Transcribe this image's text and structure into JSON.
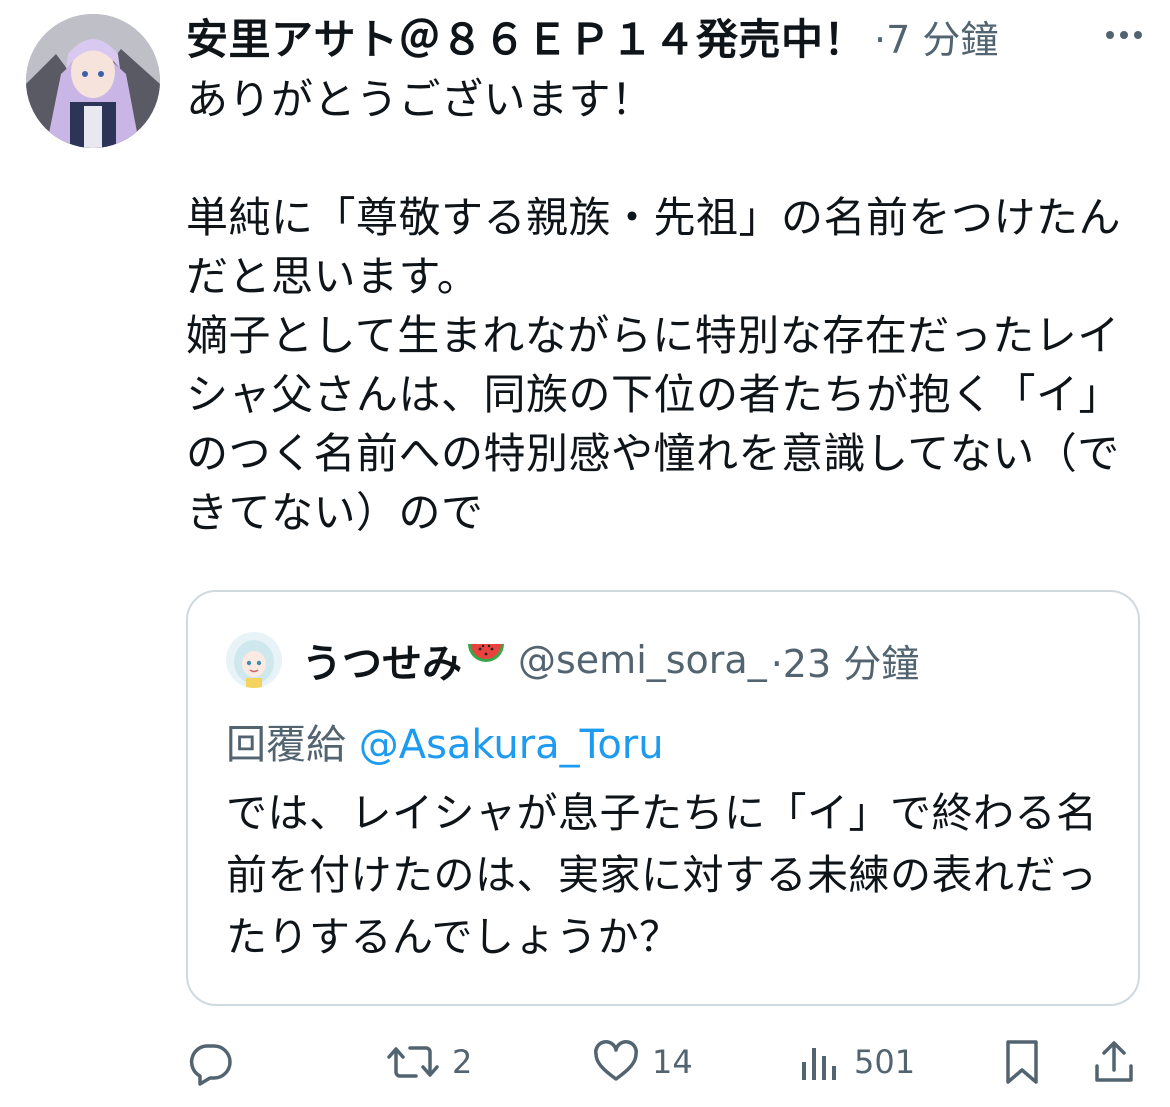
{
  "tweet": {
    "display_name": "安里アサト＠８６ＥＰ１４発売中！",
    "time": "·7 分鐘",
    "text": "ありがとうございます！\n\n単純に「尊敬する親族・先祖」の名前をつけたんだと思います。\n嫡子として生まれながらに特別な存在だったレイシャ父さんは、同族の下位の者たちが抱く「イ」のつく名前への特別感や憧れを意識してない（できてない）ので"
  },
  "quoted": {
    "display_name": "うつせみ",
    "handle": "@semi_sora_",
    "time": "·23 分鐘",
    "reply_prefix": "回覆給",
    "reply_mention": "@Asakura_Toru",
    "text": "では、レイシャが息子たちに「イ」で終わる名前を付けたのは、実家に対する未練の表れだったりするんでしょうか？"
  },
  "actions": {
    "reply_count": "",
    "retweet_count": "2",
    "like_count": "14",
    "view_count": "501"
  },
  "colors": {
    "text": "#0f1419",
    "secondary": "#536471",
    "link": "#1d9bf0",
    "border": "#cfd9de"
  }
}
